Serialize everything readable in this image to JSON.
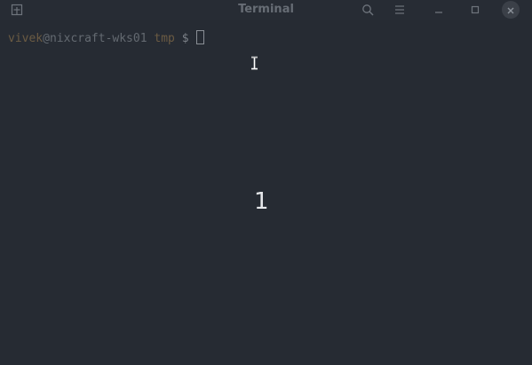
{
  "window": {
    "title": "Terminal"
  },
  "titlebar": {
    "new_tab_icon": "new-tab-icon",
    "search_icon": "search-icon",
    "menu_icon": "hamburger-menu-icon",
    "minimize_icon": "minimize-icon",
    "maximize_icon": "maximize-icon",
    "close_icon": "close-icon"
  },
  "terminal": {
    "prompt": {
      "user": "vivek",
      "at": "@",
      "host": "nixcraft-wks01",
      "dir": "tmp",
      "symbol": "$"
    },
    "overlay_number": "1"
  },
  "colors": {
    "background": "#262b33",
    "prompt_user": "#6b5b43",
    "prompt_host": "#646a71",
    "overlay_text": "#e6e8eb"
  }
}
